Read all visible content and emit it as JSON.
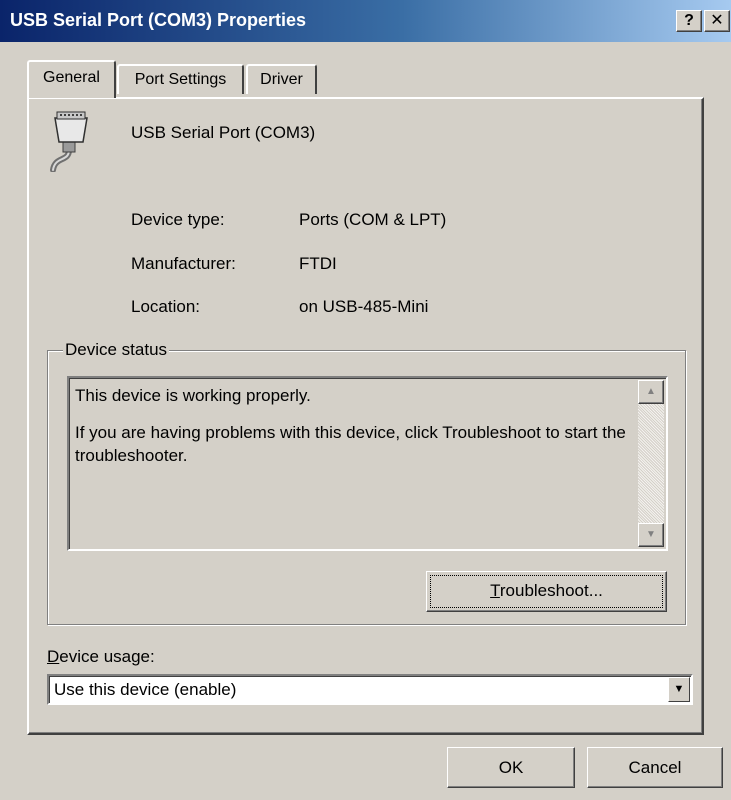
{
  "window": {
    "title": "USB Serial Port (COM3) Properties",
    "help_label": "?",
    "close_label": "✕",
    "titlebar_color": "#0a246a"
  },
  "tabs": [
    {
      "label": "General",
      "active": true
    },
    {
      "label": "Port Settings",
      "active": false
    },
    {
      "label": "Driver",
      "active": false
    }
  ],
  "device": {
    "icon": "serial-port-connector-icon",
    "name": "USB Serial Port (COM3)",
    "properties": [
      {
        "label": "Device type:",
        "value": "Ports (COM & LPT)"
      },
      {
        "label": "Manufacturer:",
        "value": "FTDI"
      },
      {
        "label": "Location:",
        "value": "on USB-485-Mini"
      }
    ]
  },
  "device_status": {
    "group_label": "Device status",
    "lines": [
      "This device is working properly.",
      "If you are having problems with this device, click Troubleshoot to start the troubleshooter."
    ],
    "troubleshoot_first_letter": "T",
    "troubleshoot_rest": "roubleshoot..."
  },
  "device_usage": {
    "label_first_letter": "D",
    "label_rest": "evice usage:",
    "selected": "Use this device (enable)"
  },
  "footer": {
    "ok_label": "OK",
    "cancel_label": "Cancel"
  }
}
